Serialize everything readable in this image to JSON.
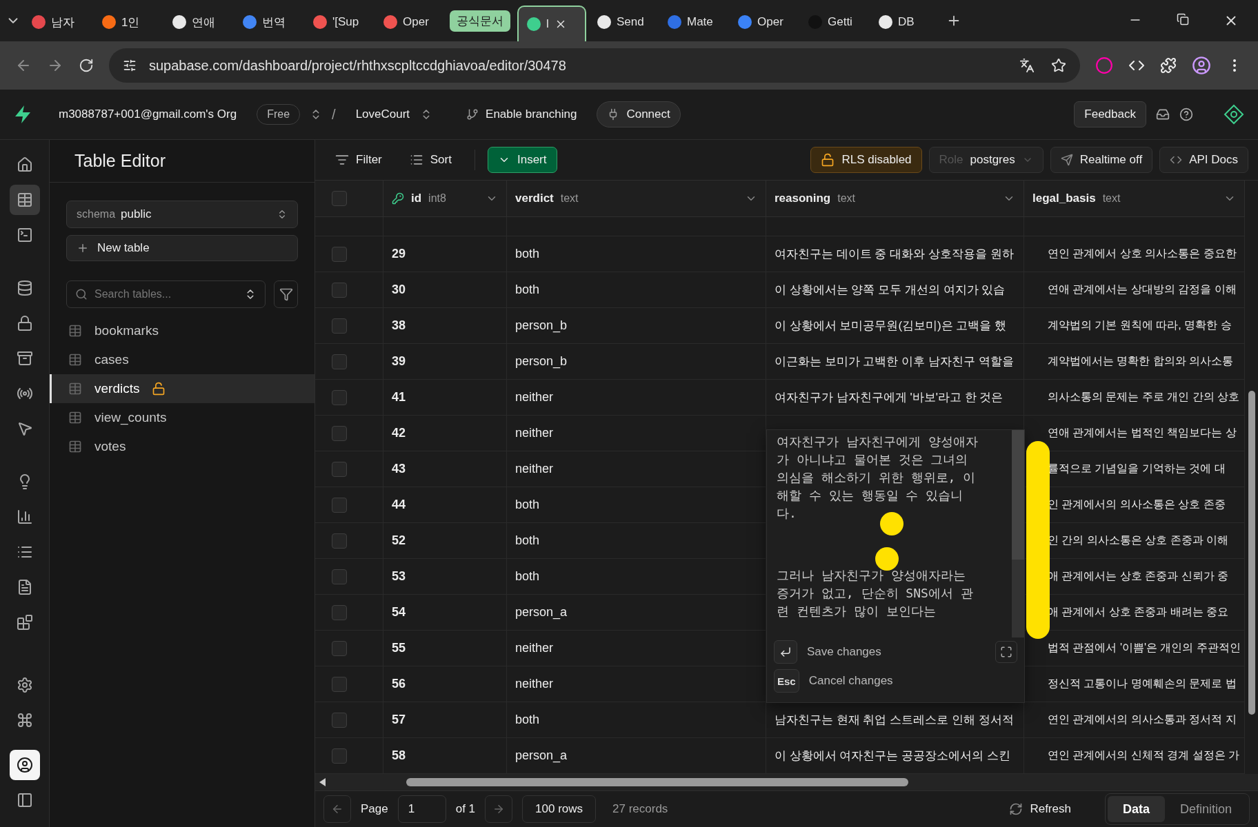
{
  "browser": {
    "tabs": [
      {
        "kind": "tab",
        "title": "남자",
        "color": "#e5484d",
        "selected": false
      },
      {
        "kind": "tab",
        "title": "1인",
        "color": "#f76b15",
        "selected": false
      },
      {
        "kind": "tab",
        "title": "연애",
        "color": "#e8e8e8",
        "selected": false
      },
      {
        "kind": "tab",
        "title": "번역",
        "color": "#4285f4",
        "selected": false
      },
      {
        "kind": "tab",
        "title": "'[Sup",
        "color": "#ef5350",
        "selected": false
      },
      {
        "kind": "tab",
        "title": "Oper",
        "color": "#ef5350",
        "selected": false
      },
      {
        "kind": "group",
        "title": "공식문서",
        "color": "#8fd19e"
      },
      {
        "kind": "tab",
        "title": "l",
        "color": "#3ecf8e",
        "selected": true
      },
      {
        "kind": "tab",
        "title": "Send",
        "color": "#e8e8e8",
        "selected": false
      },
      {
        "kind": "tab",
        "title": "Mate",
        "color": "#2f6fe4",
        "selected": false
      },
      {
        "kind": "tab",
        "title": "Oper",
        "color": "#3b82f6",
        "selected": false
      },
      {
        "kind": "tab",
        "title": "Getti",
        "color": "#111111",
        "selected": false
      },
      {
        "kind": "tab",
        "title": "DB",
        "color": "#e8e8e8",
        "selected": false
      }
    ],
    "url": "supabase.com/dashboard/project/rhthxscpltccdghiavoa/editor/30478"
  },
  "header": {
    "org": "m3088787+001@gmail.com's Org",
    "plan": "Free",
    "separator": "/",
    "project": "LoveCourt",
    "branching": "Enable branching",
    "connect": "Connect",
    "feedback": "Feedback"
  },
  "rail": [
    {
      "kind": "home",
      "selected": false
    },
    {
      "kind": "table",
      "selected": true
    },
    {
      "kind": "sql",
      "selected": false
    },
    {
      "kind": "database",
      "selected": false
    },
    {
      "kind": "auth",
      "selected": false
    },
    {
      "kind": "storage",
      "selected": false
    },
    {
      "kind": "realtime",
      "selected": false
    },
    {
      "kind": "cursor",
      "selected": false
    },
    {
      "kind": "advisor",
      "selected": false
    },
    {
      "kind": "reports",
      "selected": false
    },
    {
      "kind": "logs",
      "selected": false
    },
    {
      "kind": "docs",
      "selected": false
    },
    {
      "kind": "integrations",
      "selected": false
    },
    {
      "kind": "settings",
      "selected": false
    },
    {
      "kind": "command",
      "selected": false
    },
    {
      "kind": "user",
      "selected": false
    },
    {
      "kind": "panel",
      "selected": false
    }
  ],
  "sidebar": {
    "title": "Table Editor",
    "schema_label": "schema",
    "schema": "public",
    "new_table": "New table",
    "search": {
      "placeholder": "Search tables..."
    },
    "tables": [
      {
        "name": "bookmarks",
        "selected": false,
        "locked": false
      },
      {
        "name": "cases",
        "selected": false,
        "locked": false
      },
      {
        "name": "verdicts",
        "selected": true,
        "locked": true
      },
      {
        "name": "view_counts",
        "selected": false,
        "locked": false
      },
      {
        "name": "votes",
        "selected": false,
        "locked": false
      }
    ]
  },
  "toolbar": {
    "filter": "Filter",
    "sort": "Sort",
    "insert": "Insert",
    "rls": "RLS disabled",
    "role_label": "Role",
    "role": "postgres",
    "realtime": "Realtime off",
    "api_docs": "API Docs"
  },
  "table": {
    "all_checked": false,
    "columns": [
      {
        "name": "id",
        "type": "int8",
        "primary_key": true
      },
      {
        "name": "verdict",
        "type": "text",
        "primary_key": false
      },
      {
        "name": "reasoning",
        "type": "text",
        "primary_key": false
      },
      {
        "name": "legal_basis",
        "type": "text",
        "primary_key": false
      }
    ],
    "rows": [
      {
        "checked": false,
        "id": "29",
        "verdict": "both",
        "reasoning": "여자친구는 데이트 중 대화와 상호작용을 원하",
        "legal_basis": "연인 관계에서 상호 의사소통은 중요한"
      },
      {
        "checked": false,
        "id": "30",
        "verdict": "both",
        "reasoning": "이 상황에서는 양쪽 모두 개선의 여지가 있습",
        "legal_basis": "연애 관계에서는 상대방의 감정을 이해"
      },
      {
        "checked": false,
        "id": "38",
        "verdict": "person_b",
        "reasoning": "이 상황에서 보미공무원(김보미)은 고백을 했",
        "legal_basis": "계약법의 기본 원칙에 따라, 명확한 승"
      },
      {
        "checked": false,
        "id": "39",
        "verdict": "person_b",
        "reasoning": "이근화는 보미가 고백한 이후 남자친구 역할을",
        "legal_basis": "계약법에서는 명확한 합의와 의사소통"
      },
      {
        "checked": false,
        "id": "41",
        "verdict": "neither",
        "reasoning": "여자친구가 남자친구에게 '바보'라고 한 것은",
        "legal_basis": "의사소통의 문제는 주로 개인 간의 상호"
      },
      {
        "checked": false,
        "id": "42",
        "verdict": "neither",
        "legal_basis": "연애 관계에서는 법적인 책임보다는 상"
      },
      {
        "checked": false,
        "id": "43",
        "verdict": "neither",
        "legal_basis": "률적으로 기념일을 기억하는 것에 대"
      },
      {
        "checked": false,
        "id": "44",
        "verdict": "both",
        "legal_basis": "인 관계에서의 의사소통은 상호 존중"
      },
      {
        "checked": false,
        "id": "52",
        "verdict": "both",
        "legal_basis": "인 간의 의사소통은 상호 존중과 이해"
      },
      {
        "checked": false,
        "id": "53",
        "verdict": "both",
        "legal_basis": "애 관계에서는 상호 존중과 신뢰가 중"
      },
      {
        "checked": false,
        "id": "54",
        "verdict": "person_a",
        "legal_basis": "애 관계에서 상호 존중과 배려는 중요"
      },
      {
        "checked": false,
        "id": "55",
        "verdict": "neither",
        "legal_basis": "법적 관점에서 '이쁨'은 개인의 주관적인"
      },
      {
        "checked": false,
        "id": "56",
        "verdict": "neither",
        "legal_basis": "정신적 고통이나 명예훼손의 문제로 법"
      },
      {
        "checked": false,
        "id": "57",
        "verdict": "both",
        "reasoning": "남자친구는 현재 취업 스트레스로 인해 정서적",
        "legal_basis": "연인 관계에서의 의사소통과 정서적 지"
      },
      {
        "checked": false,
        "id": "58",
        "verdict": "person_a",
        "reasoning": "이 상황에서 여자친구는 공공장소에서의 스킨",
        "legal_basis": "연인 관계에서의 신체적 경계 설정은 가"
      }
    ]
  },
  "cell_editor": {
    "paragraphs": [
      "여자친구가 남자친구에게 양성애자가 아니냐고 물어본 것은 그녀의 의심을 해소하기 위한 행위로, 이해할 수 있는 행동일 수 있습니다.",
      "그러나 남자친구가 양성애자라는 증거가 없고, 단순히 SNS에서 관련 컨텐츠가 많이 보인다는"
    ],
    "save": "Save changes",
    "cancel_key": "Esc",
    "cancel": "Cancel changes"
  },
  "footer": {
    "page_label": "Page",
    "page": "1",
    "of": "of 1",
    "rows": "100 rows",
    "records": "27 records",
    "refresh": "Refresh",
    "views": [
      {
        "label": "Data",
        "selected": true
      },
      {
        "label": "Definition",
        "selected": false
      }
    ]
  }
}
